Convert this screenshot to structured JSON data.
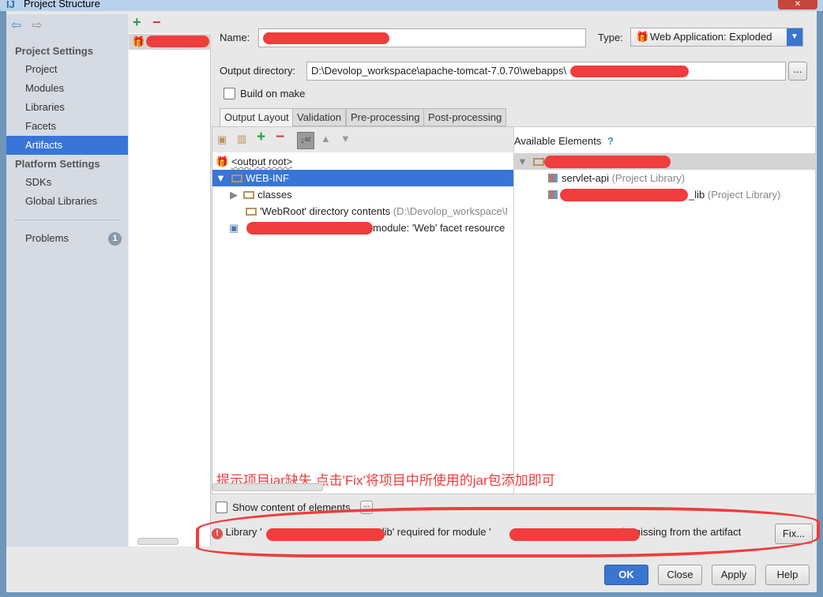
{
  "window": {
    "title": "Project Structure",
    "app_icon": "intellij-icon"
  },
  "sidebar": {
    "project_settings_header": "Project Settings",
    "items": [
      {
        "label": "Project"
      },
      {
        "label": "Modules"
      },
      {
        "label": "Libraries"
      },
      {
        "label": "Facets"
      },
      {
        "label": "Artifacts",
        "selected": true
      }
    ],
    "platform_settings_header": "Platform Settings",
    "platform_items": [
      {
        "label": "SDKs"
      },
      {
        "label": "Global Libraries"
      }
    ],
    "problems": {
      "label": "Problems",
      "count": "1"
    }
  },
  "artifact_list": {
    "items": [
      {
        "label": "S",
        "redacted": true
      }
    ]
  },
  "form": {
    "name_label": "Name:",
    "type_label": "Type:",
    "type_value": "Web Application: Exploded",
    "output_dir_label": "Output directory:",
    "output_dir_value": "D:\\Devolop_workspace\\apache-tomcat-7.0.70\\webapps\\",
    "build_on_make": "Build on make"
  },
  "tabs": [
    {
      "label": "Output Layout",
      "selected": true
    },
    {
      "label": "Validation"
    },
    {
      "label": "Pre-processing"
    },
    {
      "label": "Post-processing"
    }
  ],
  "layout_tree": [
    {
      "label": "<output root>"
    },
    {
      "label": "WEB-INF",
      "selected": true
    },
    {
      "label": "classes"
    },
    {
      "label": "'WebRoot' directory contents",
      "hint": "(D:\\Devolop_workspace\\I"
    },
    {
      "label": "' module: 'Web' facet resource"
    }
  ],
  "available": {
    "title": "Available Elements",
    "help": "?",
    "items": [
      {
        "label": "servlet-api",
        "hint": "(Project Library)"
      },
      {
        "label": "_lib",
        "hint": "(Project Library)"
      }
    ]
  },
  "annotation": "提示项目jar缺失,点击'Fix'将项目中所使用的jar包添加即可",
  "show_content": "Show content of elements",
  "ellipsis": "...",
  "problem": {
    "prefix": "Library '",
    "middle": "_lib' required for module '",
    "suffix": "is missing from the artifact",
    "fix": "Fix..."
  },
  "buttons": {
    "ok": "OK",
    "close": "Close",
    "apply": "Apply",
    "help": "Help"
  },
  "colors": {
    "selection": "#3875d7",
    "annotation": "#f03d3d"
  }
}
